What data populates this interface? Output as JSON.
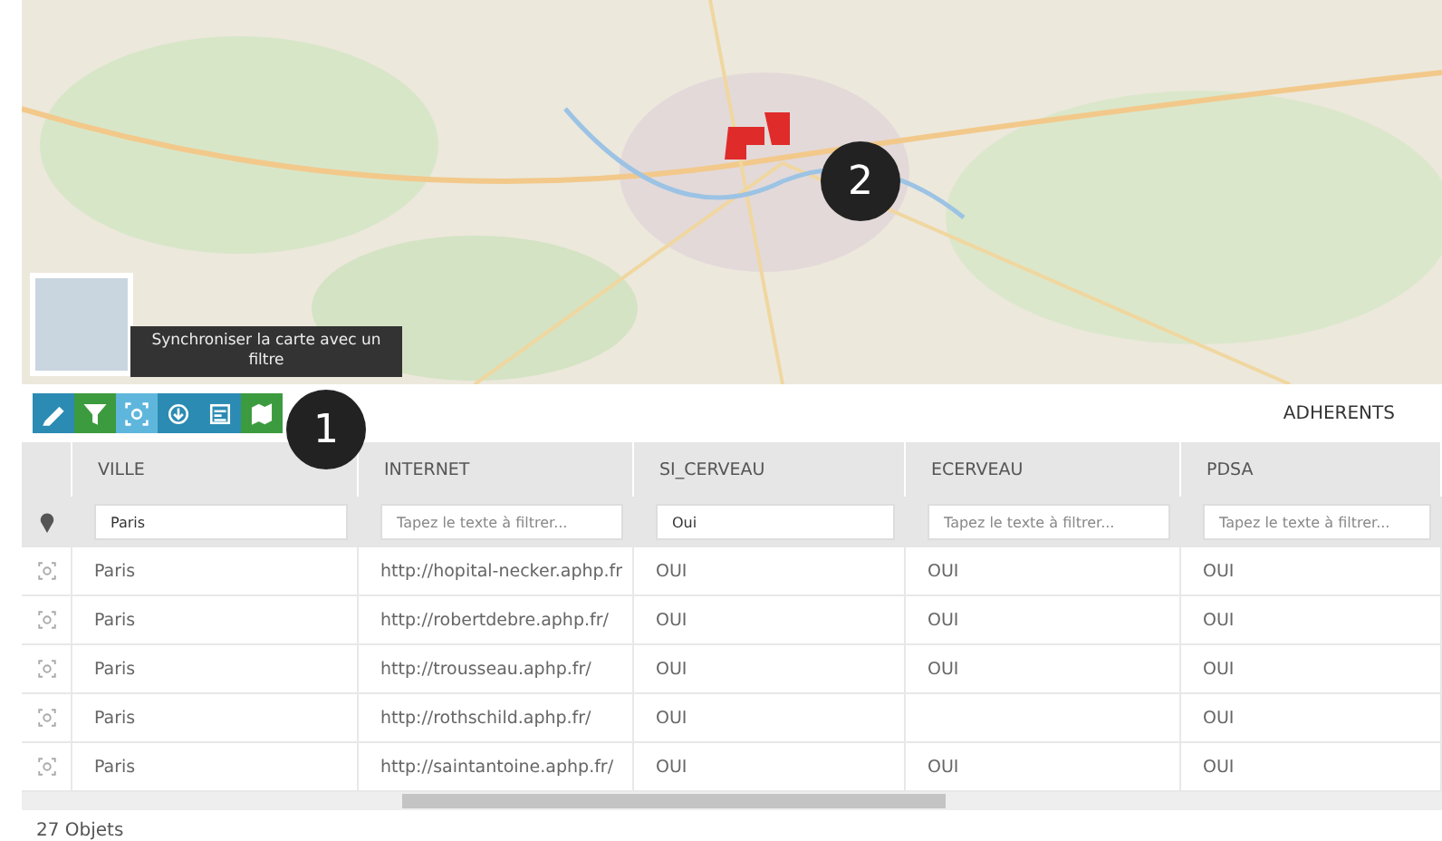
{
  "toolbar": [
    {
      "kind": "pencil",
      "color": "#2b8bb3",
      "selected": false
    },
    {
      "kind": "filter",
      "color": "#3c9b3e",
      "selected": false
    },
    {
      "kind": "zoom",
      "selected": true
    },
    {
      "kind": "download",
      "color": "#2b8bb3",
      "selected": false
    },
    {
      "kind": "form",
      "color": "#2b8bb3",
      "selected": false
    },
    {
      "kind": "map",
      "color": "#3c9b3e",
      "selected": false
    }
  ],
  "tooltip": "Synchroniser la carte avec un filtre",
  "callouts": [
    "1",
    "2"
  ],
  "layer_title": "ADHERENTS",
  "table": {
    "columns": [
      {
        "title": "VILLE",
        "filter_value": "Paris"
      },
      {
        "title": "INTERNET",
        "placeholder": "Tapez le texte à filtrer..."
      },
      {
        "title": "SI_CERVEAU",
        "filter_value": "Oui"
      },
      {
        "title": "ECERVEAU",
        "placeholder": "Tapez le texte à filtrer..."
      },
      {
        "title": "PDSA",
        "placeholder": "Tapez le texte à filtrer..."
      }
    ],
    "rows": [
      [
        "Paris",
        "http://hopital-necker.aphp.fr",
        "OUI",
        "OUI",
        "OUI"
      ],
      [
        "Paris",
        "http://robertdebre.aphp.fr/",
        "OUI",
        "OUI",
        "OUI"
      ],
      [
        "Paris",
        "http://trousseau.aphp.fr/",
        "OUI",
        "OUI",
        "OUI"
      ],
      [
        "Paris",
        "http://rothschild.aphp.fr/",
        "OUI",
        "",
        "OUI"
      ],
      [
        "Paris",
        "http://saintantoine.aphp.fr/",
        "OUI",
        "OUI",
        "OUI"
      ]
    ]
  },
  "status_bar": "27 Objets"
}
